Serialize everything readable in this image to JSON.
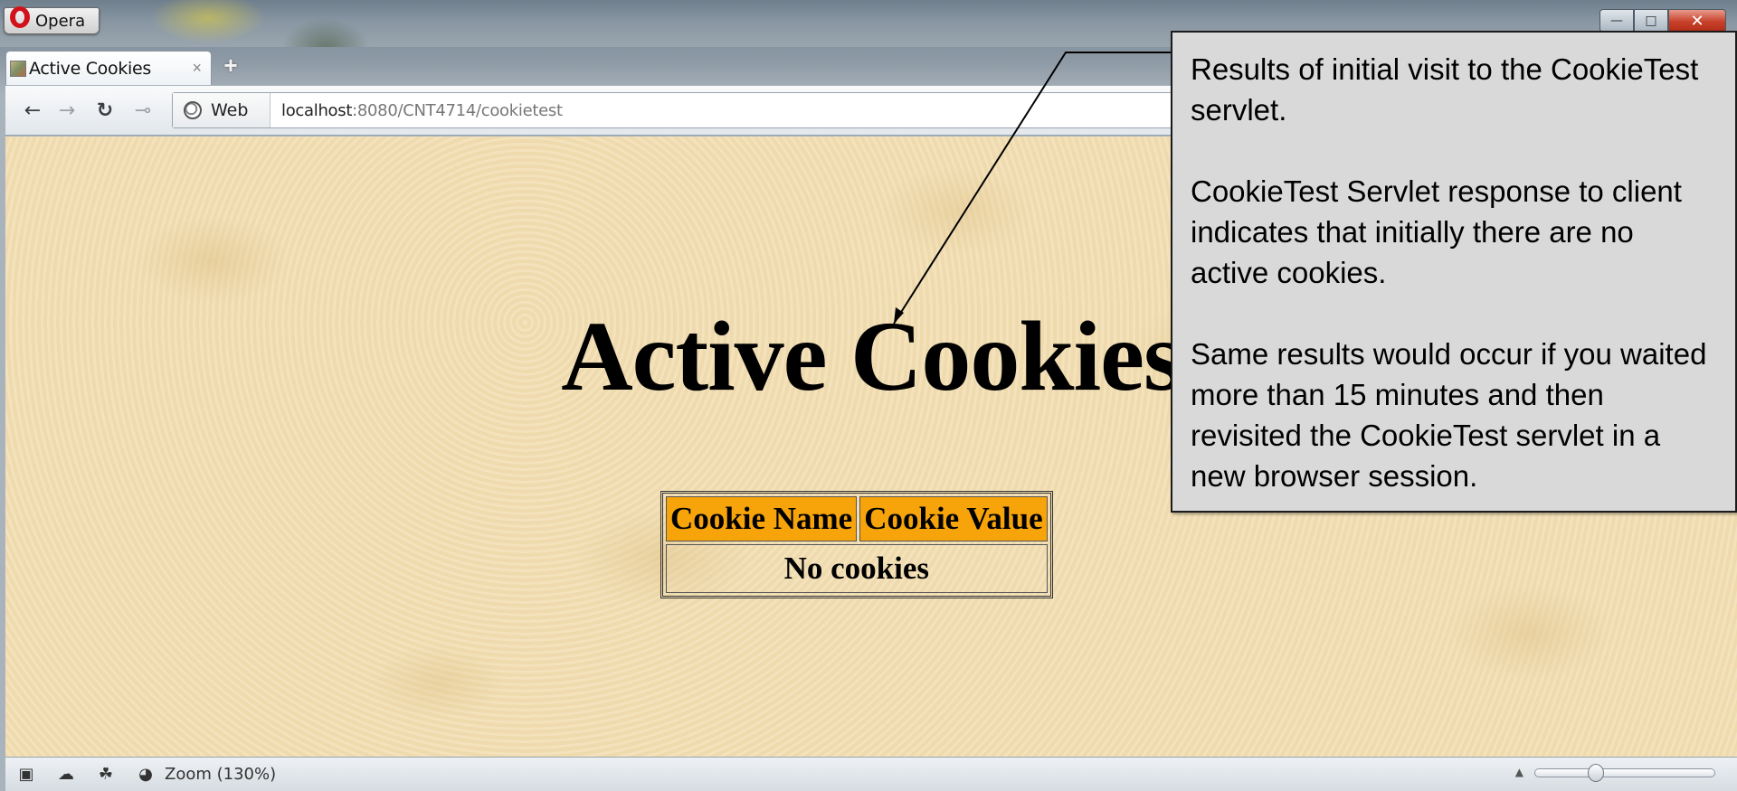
{
  "browser": {
    "menu_label": "Opera",
    "tab": {
      "label": "Active Cookies"
    },
    "address": {
      "site_badge": "Web",
      "host": "localhost",
      "path": ":8080/CNT4714/cookietest"
    },
    "status": {
      "zoom": "Zoom (130%)",
      "zoom_fraction": 0.32
    }
  },
  "page": {
    "heading": "Active Cookies",
    "table": {
      "headers": [
        "Cookie Name",
        "Cookie Value"
      ],
      "empty_message": "No cookies",
      "header_color": "#f7a30a"
    }
  },
  "callout": {
    "paragraphs": [
      "Results of initial visit to the CookieTest servlet.",
      "CookieTest Servlet response to client indicates that initially there are no active cookies.",
      "Same results would occur if you waited more than 15 minutes and then revisited the CookieTest servlet in a new browser session."
    ]
  },
  "icons": [
    "opera-logo-icon",
    "tab-favicon-icon",
    "close-icon",
    "plus-icon",
    "back-icon",
    "forward-icon",
    "reload-icon",
    "key-icon",
    "globe-icon",
    "panel-icon",
    "cloud-icon",
    "unite-icon",
    "speed-icon",
    "zoom-slider-icon"
  ]
}
